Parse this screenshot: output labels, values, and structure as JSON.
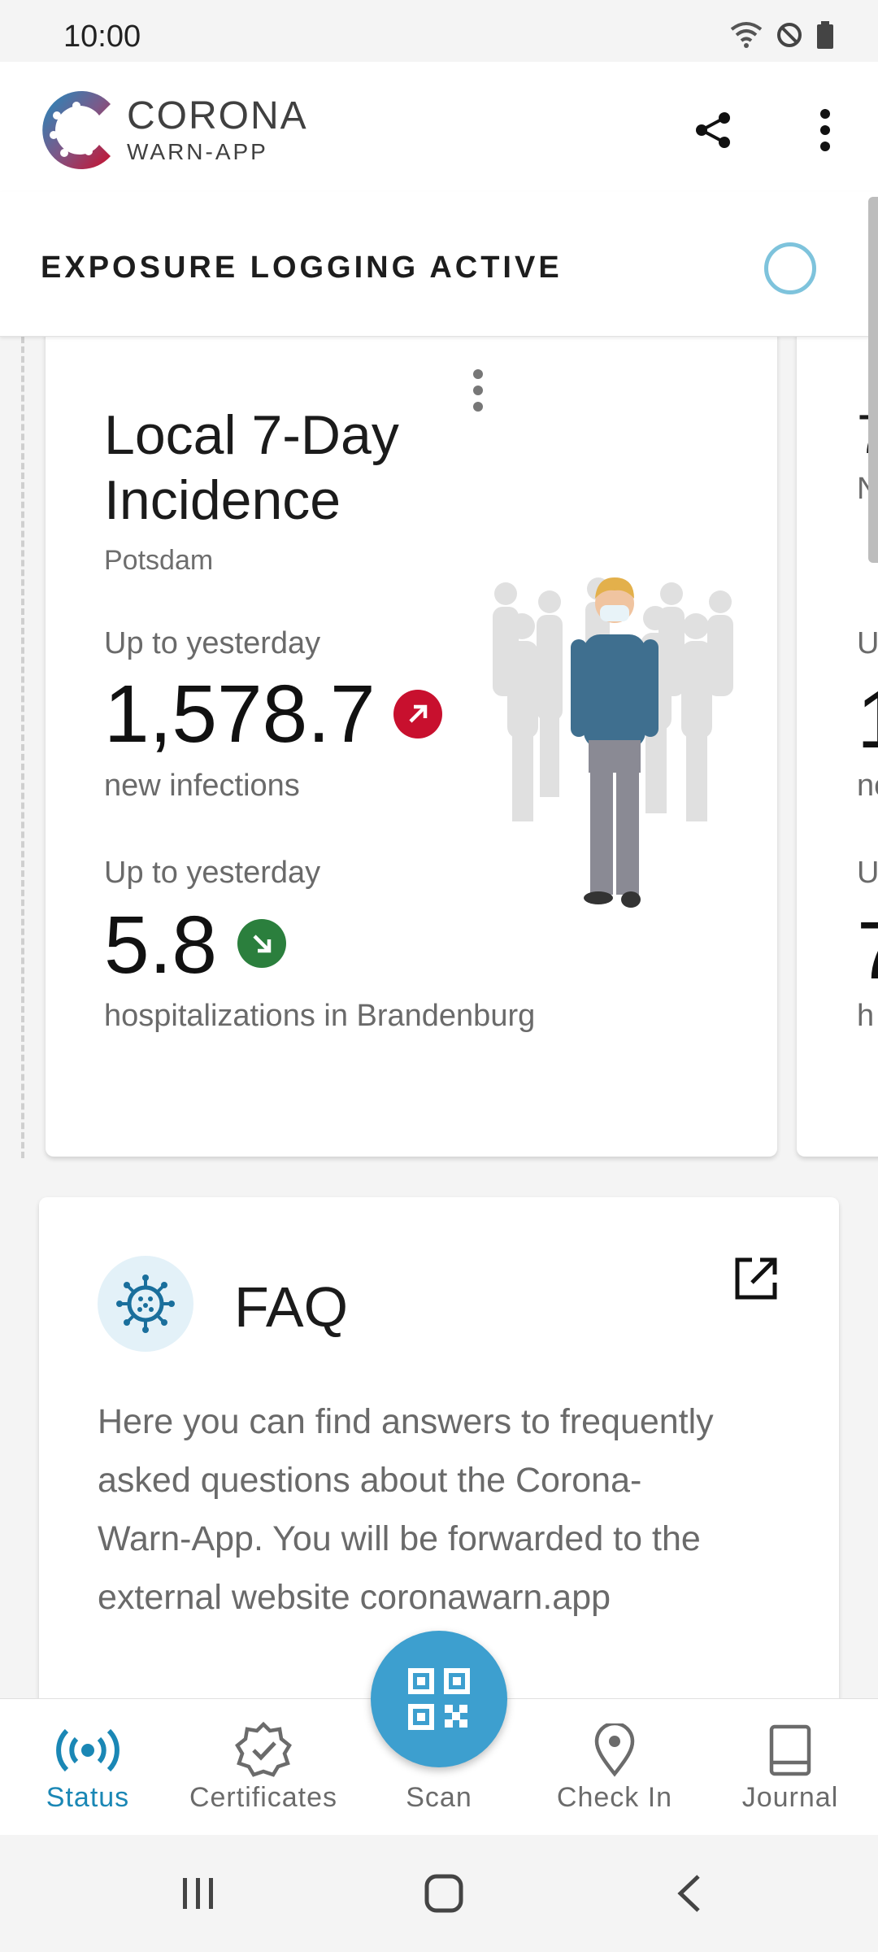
{
  "status_bar": {
    "time": "10:00"
  },
  "header": {
    "logo_title": "CORONA",
    "logo_subtitle": "WARN-APP"
  },
  "exposure": {
    "label": "EXPOSURE LOGGING ACTIVE",
    "ring_color": "#7ec3dc"
  },
  "incidence_card": {
    "title": "Local 7-Day Incidence",
    "location": "Potsdam",
    "infections": {
      "period": "Up to yesterday",
      "value": "1,578.7",
      "caption": "new infections",
      "trend": "up",
      "trend_color": "#c8102e"
    },
    "hospitalizations": {
      "period": "Up to yesterday",
      "value": "5.8",
      "caption": "hospitalizations in Brandenburg",
      "trend": "down",
      "trend_color": "#2b7f3d"
    },
    "illustration": "person-with-mask-in-crowd"
  },
  "next_card_partial": {
    "title": "7",
    "sub": "N",
    "l1": "U",
    "v1": "1",
    "c1": "ne",
    "l2": "U",
    "v2": "7",
    "c2": "h"
  },
  "faq": {
    "title": "FAQ",
    "text": "Here you can find answers to frequently asked questions about the Corona-Warn-App. You will be forwarded to the external website coronawarn.app"
  },
  "bottom_nav": {
    "items": [
      {
        "label": "Status",
        "icon": "broadcast-icon",
        "active": true
      },
      {
        "label": "Certificates",
        "icon": "certificate-icon",
        "active": false
      },
      {
        "label": "Scan",
        "icon": "qr-code-icon",
        "active": false
      },
      {
        "label": "Check In",
        "icon": "location-pin-icon",
        "active": false
      },
      {
        "label": "Journal",
        "icon": "book-icon",
        "active": false
      }
    ]
  },
  "colors": {
    "accent": "#1a87b5",
    "fab": "#3d9fcf",
    "brand_red": "#c8102e"
  }
}
